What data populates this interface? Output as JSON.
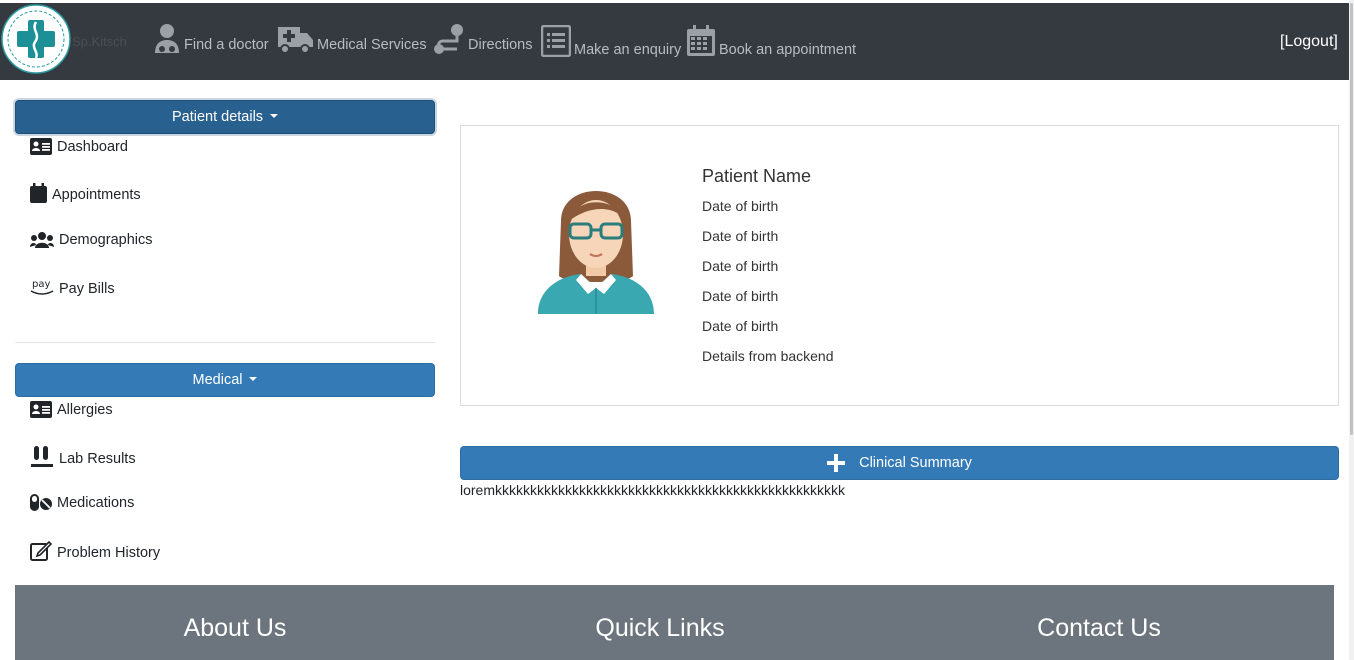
{
  "header": {
    "logo_text": "Sp.Kitsch",
    "nav": [
      {
        "label": "Find a doctor",
        "icon": "doctor-icon"
      },
      {
        "label": "Medical Services",
        "icon": "ambulance-icon"
      },
      {
        "label": "Directions",
        "icon": "route-icon"
      },
      {
        "label": "Make an enquiry",
        "icon": "list-form-icon"
      },
      {
        "label": "Book an appointment",
        "icon": "calendar-icon"
      }
    ],
    "logout": "[Logout]"
  },
  "sidebar": {
    "patient_button": "Patient details",
    "patient_items": [
      {
        "label": "Dashboard",
        "icon": "id-card-icon"
      },
      {
        "label": "Appointments",
        "icon": "calendar-icon"
      },
      {
        "label": "Demographics",
        "icon": "users-icon"
      },
      {
        "label": "Pay Bills",
        "icon": "amazon-pay-icon"
      }
    ],
    "medical_button": "Medical",
    "medical_items": [
      {
        "label": "Allergies",
        "icon": "id-card-icon"
      },
      {
        "label": "Lab Results",
        "icon": "vials-icon"
      },
      {
        "label": "Medications",
        "icon": "pills-icon"
      },
      {
        "label": "Problem History",
        "icon": "edit-icon"
      }
    ]
  },
  "patient": {
    "name": "Patient Name",
    "lines": [
      "Date of birth",
      "Date of birth",
      "Date of birth",
      "Date of birth",
      "Date of birth",
      "Details from backend"
    ]
  },
  "clinical": {
    "button": "Clinical Summary",
    "text": "loremkkkkkkkkkkkkkkkkkkkkkkkkkkkkkkkkkkkkkkkkkkkkkkkkkk"
  },
  "footer": {
    "about": "About Us",
    "links": "Quick Links",
    "contact": "Contact Us"
  },
  "colors": {
    "navbar": "#343a40",
    "primary": "#337ab7",
    "footer": "#6c757d"
  }
}
